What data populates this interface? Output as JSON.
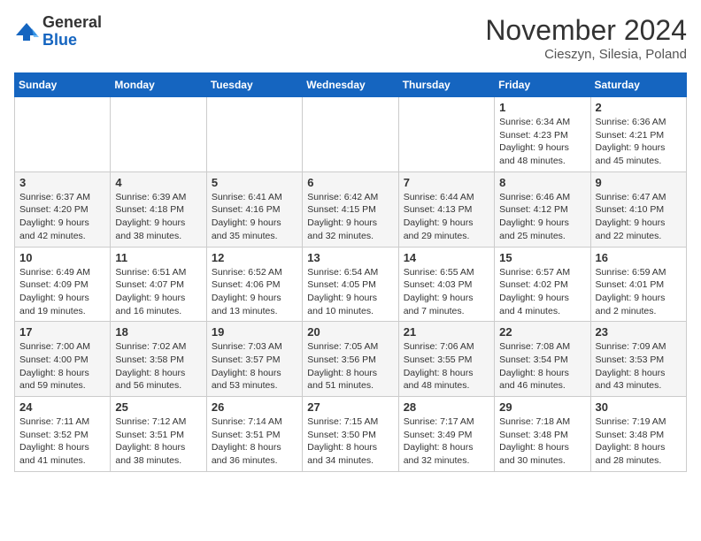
{
  "logo": {
    "general": "General",
    "blue": "Blue"
  },
  "header": {
    "month": "November 2024",
    "location": "Cieszyn, Silesia, Poland"
  },
  "weekdays": [
    "Sunday",
    "Monday",
    "Tuesday",
    "Wednesday",
    "Thursday",
    "Friday",
    "Saturday"
  ],
  "weeks": [
    [
      null,
      null,
      null,
      null,
      null,
      {
        "day": "1",
        "sunrise": "6:34 AM",
        "sunset": "4:23 PM",
        "daylight": "9 hours and 48 minutes."
      },
      {
        "day": "2",
        "sunrise": "6:36 AM",
        "sunset": "4:21 PM",
        "daylight": "9 hours and 45 minutes."
      }
    ],
    [
      {
        "day": "3",
        "sunrise": "6:37 AM",
        "sunset": "4:20 PM",
        "daylight": "9 hours and 42 minutes."
      },
      {
        "day": "4",
        "sunrise": "6:39 AM",
        "sunset": "4:18 PM",
        "daylight": "9 hours and 38 minutes."
      },
      {
        "day": "5",
        "sunrise": "6:41 AM",
        "sunset": "4:16 PM",
        "daylight": "9 hours and 35 minutes."
      },
      {
        "day": "6",
        "sunrise": "6:42 AM",
        "sunset": "4:15 PM",
        "daylight": "9 hours and 32 minutes."
      },
      {
        "day": "7",
        "sunrise": "6:44 AM",
        "sunset": "4:13 PM",
        "daylight": "9 hours and 29 minutes."
      },
      {
        "day": "8",
        "sunrise": "6:46 AM",
        "sunset": "4:12 PM",
        "daylight": "9 hours and 25 minutes."
      },
      {
        "day": "9",
        "sunrise": "6:47 AM",
        "sunset": "4:10 PM",
        "daylight": "9 hours and 22 minutes."
      }
    ],
    [
      {
        "day": "10",
        "sunrise": "6:49 AM",
        "sunset": "4:09 PM",
        "daylight": "9 hours and 19 minutes."
      },
      {
        "day": "11",
        "sunrise": "6:51 AM",
        "sunset": "4:07 PM",
        "daylight": "9 hours and 16 minutes."
      },
      {
        "day": "12",
        "sunrise": "6:52 AM",
        "sunset": "4:06 PM",
        "daylight": "9 hours and 13 minutes."
      },
      {
        "day": "13",
        "sunrise": "6:54 AM",
        "sunset": "4:05 PM",
        "daylight": "9 hours and 10 minutes."
      },
      {
        "day": "14",
        "sunrise": "6:55 AM",
        "sunset": "4:03 PM",
        "daylight": "9 hours and 7 minutes."
      },
      {
        "day": "15",
        "sunrise": "6:57 AM",
        "sunset": "4:02 PM",
        "daylight": "9 hours and 4 minutes."
      },
      {
        "day": "16",
        "sunrise": "6:59 AM",
        "sunset": "4:01 PM",
        "daylight": "9 hours and 2 minutes."
      }
    ],
    [
      {
        "day": "17",
        "sunrise": "7:00 AM",
        "sunset": "4:00 PM",
        "daylight": "8 hours and 59 minutes."
      },
      {
        "day": "18",
        "sunrise": "7:02 AM",
        "sunset": "3:58 PM",
        "daylight": "8 hours and 56 minutes."
      },
      {
        "day": "19",
        "sunrise": "7:03 AM",
        "sunset": "3:57 PM",
        "daylight": "8 hours and 53 minutes."
      },
      {
        "day": "20",
        "sunrise": "7:05 AM",
        "sunset": "3:56 PM",
        "daylight": "8 hours and 51 minutes."
      },
      {
        "day": "21",
        "sunrise": "7:06 AM",
        "sunset": "3:55 PM",
        "daylight": "8 hours and 48 minutes."
      },
      {
        "day": "22",
        "sunrise": "7:08 AM",
        "sunset": "3:54 PM",
        "daylight": "8 hours and 46 minutes."
      },
      {
        "day": "23",
        "sunrise": "7:09 AM",
        "sunset": "3:53 PM",
        "daylight": "8 hours and 43 minutes."
      }
    ],
    [
      {
        "day": "24",
        "sunrise": "7:11 AM",
        "sunset": "3:52 PM",
        "daylight": "8 hours and 41 minutes."
      },
      {
        "day": "25",
        "sunrise": "7:12 AM",
        "sunset": "3:51 PM",
        "daylight": "8 hours and 38 minutes."
      },
      {
        "day": "26",
        "sunrise": "7:14 AM",
        "sunset": "3:51 PM",
        "daylight": "8 hours and 36 minutes."
      },
      {
        "day": "27",
        "sunrise": "7:15 AM",
        "sunset": "3:50 PM",
        "daylight": "8 hours and 34 minutes."
      },
      {
        "day": "28",
        "sunrise": "7:17 AM",
        "sunset": "3:49 PM",
        "daylight": "8 hours and 32 minutes."
      },
      {
        "day": "29",
        "sunrise": "7:18 AM",
        "sunset": "3:48 PM",
        "daylight": "8 hours and 30 minutes."
      },
      {
        "day": "30",
        "sunrise": "7:19 AM",
        "sunset": "3:48 PM",
        "daylight": "8 hours and 28 minutes."
      }
    ]
  ],
  "labels": {
    "sunrise": "Sunrise:",
    "sunset": "Sunset:",
    "daylight": "Daylight:"
  },
  "colors": {
    "header_bg": "#1565c0",
    "row_alt": "#f5f5f5"
  }
}
